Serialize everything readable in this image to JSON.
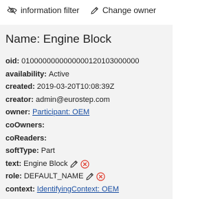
{
  "toolbar": {
    "info_filter_label": "information filter",
    "change_owner_label": "Change owner",
    "info_filter_icon": "eye-off-icon",
    "change_owner_icon": "pencil-icon"
  },
  "panel": {
    "title": "Name: Engine Block",
    "properties": [
      {
        "key": "oid:",
        "value": "0100000000000000120103000000"
      },
      {
        "key": "availability:",
        "value": "Active"
      },
      {
        "key": "created:",
        "value": "2019-03-20T10:08:39Z"
      },
      {
        "key": "creator:",
        "value": "admin@eurostep.com"
      },
      {
        "key": "owner:",
        "value": "Participant: OEM"
      },
      {
        "key": "coOwners:",
        "value": ""
      },
      {
        "key": "coReaders:",
        "value": ""
      },
      {
        "key": "softType:",
        "value": "Part"
      },
      {
        "key": "text:",
        "value": "Engine Block"
      },
      {
        "key": "role:",
        "value": "DEFAULT_NAME"
      },
      {
        "key": "context:",
        "value": "IdentifyingContext: OEM"
      }
    ]
  },
  "colors": {
    "panel_bg": "#f3f3f3",
    "link": "#1a4fa3",
    "delete_icon": "#e0392b"
  }
}
